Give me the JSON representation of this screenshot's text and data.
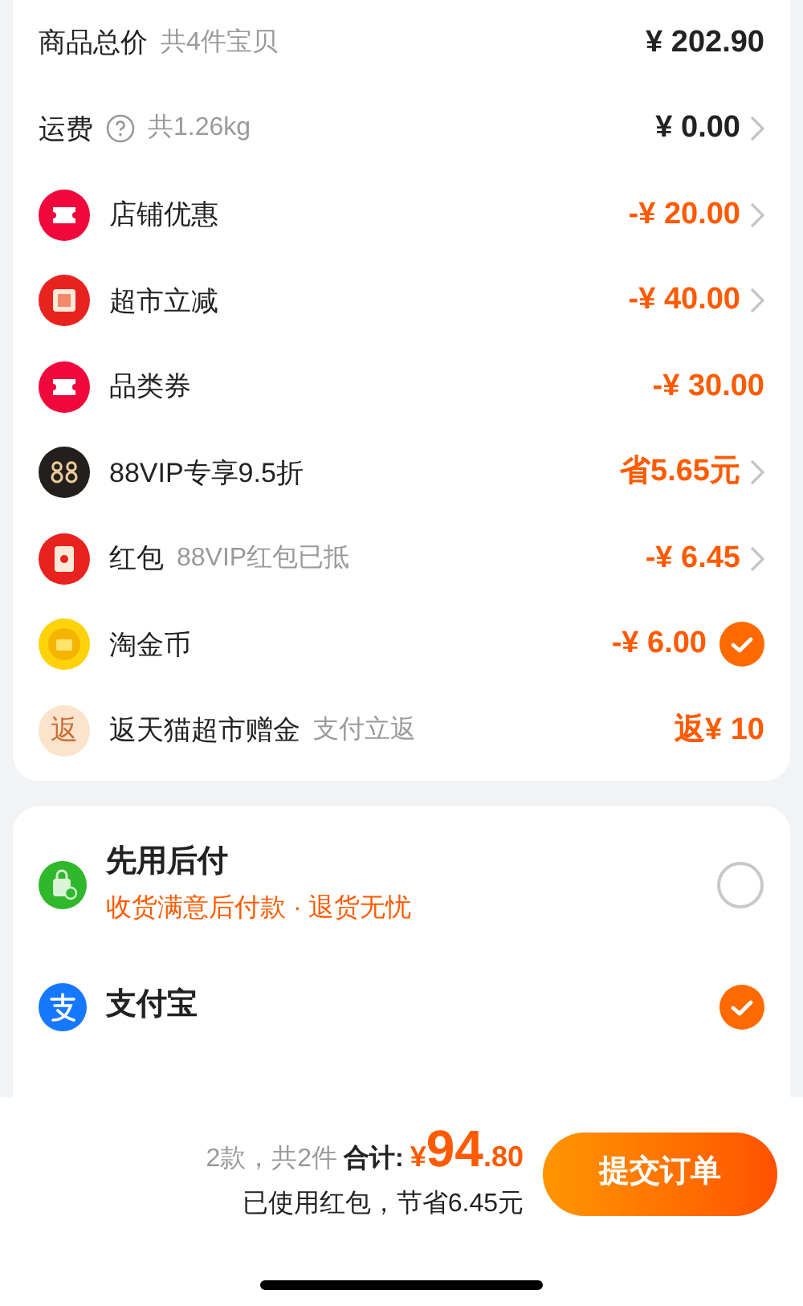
{
  "summary_rows": [
    {
      "kind": "total",
      "label": "商品总价",
      "note": "共4件宝贝",
      "value": "¥ 202.90",
      "highlight": false,
      "chevron": false
    },
    {
      "kind": "shipping",
      "label": "运费",
      "note": "共1.26kg",
      "value": "¥ 0.00",
      "highlight": false,
      "chevron": true
    },
    {
      "kind": "coupon",
      "label": "店铺优惠",
      "value": "-¥ 20.00",
      "highlight": true,
      "chevron": true
    },
    {
      "kind": "reduction",
      "label": "超市立减",
      "value": "-¥ 40.00",
      "highlight": true,
      "chevron": true
    },
    {
      "kind": "coupon",
      "label": "品类券",
      "value": "-¥ 30.00",
      "highlight": true,
      "chevron": false
    },
    {
      "kind": "vip",
      "label": "88VIP专享9.5折",
      "value": "省5.65元",
      "highlight": true,
      "chevron": true
    },
    {
      "kind": "envelope",
      "label": "红包",
      "note": "88VIP红包已抵",
      "value": "-¥ 6.45",
      "highlight": true,
      "chevron": true
    },
    {
      "kind": "coin",
      "label": "淘金币",
      "value": "-¥ 6.00",
      "highlight": true,
      "checked": true
    },
    {
      "kind": "rebate",
      "badge": "返",
      "label": "返天猫超市赠金",
      "note": "支付立返",
      "value": "返¥ 10",
      "highlight": true,
      "chevron": false
    }
  ],
  "payment_methods": [
    {
      "kind": "paylater",
      "label": "先用后付",
      "subtitle": "收货满意后付款 · 退货无忧",
      "selected": false
    },
    {
      "kind": "wallet",
      "label": "支付宝",
      "selected": true
    }
  ],
  "footer": {
    "count": "2款，共2件",
    "total_label": "合计:",
    "currency": "¥",
    "total_int": "94",
    "total_dec": ".80",
    "savings": "已使用红包，节省6.45元",
    "submit": "提交订单"
  }
}
